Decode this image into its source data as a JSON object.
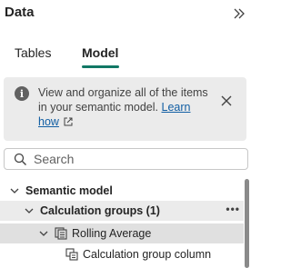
{
  "pane": {
    "title": "Data"
  },
  "tabs": [
    {
      "label": "Tables",
      "active": false
    },
    {
      "label": "Model",
      "active": true
    }
  ],
  "info_banner": {
    "text": "View and organize all of the items in your semantic model.",
    "link_text": "Learn how"
  },
  "search": {
    "placeholder": "Search",
    "value": ""
  },
  "tree": {
    "root": {
      "label": "Semantic model",
      "expanded": true
    },
    "calc_groups": {
      "label": "Calculation groups (1)",
      "expanded": true
    },
    "rolling_average": {
      "label": "Rolling Average",
      "expanded": true,
      "selected": true
    },
    "calc_group_column": {
      "label": "Calculation group column"
    }
  },
  "colors": {
    "accent": "#117865",
    "link": "#115ea3",
    "banner_bg": "#ebebeb"
  }
}
